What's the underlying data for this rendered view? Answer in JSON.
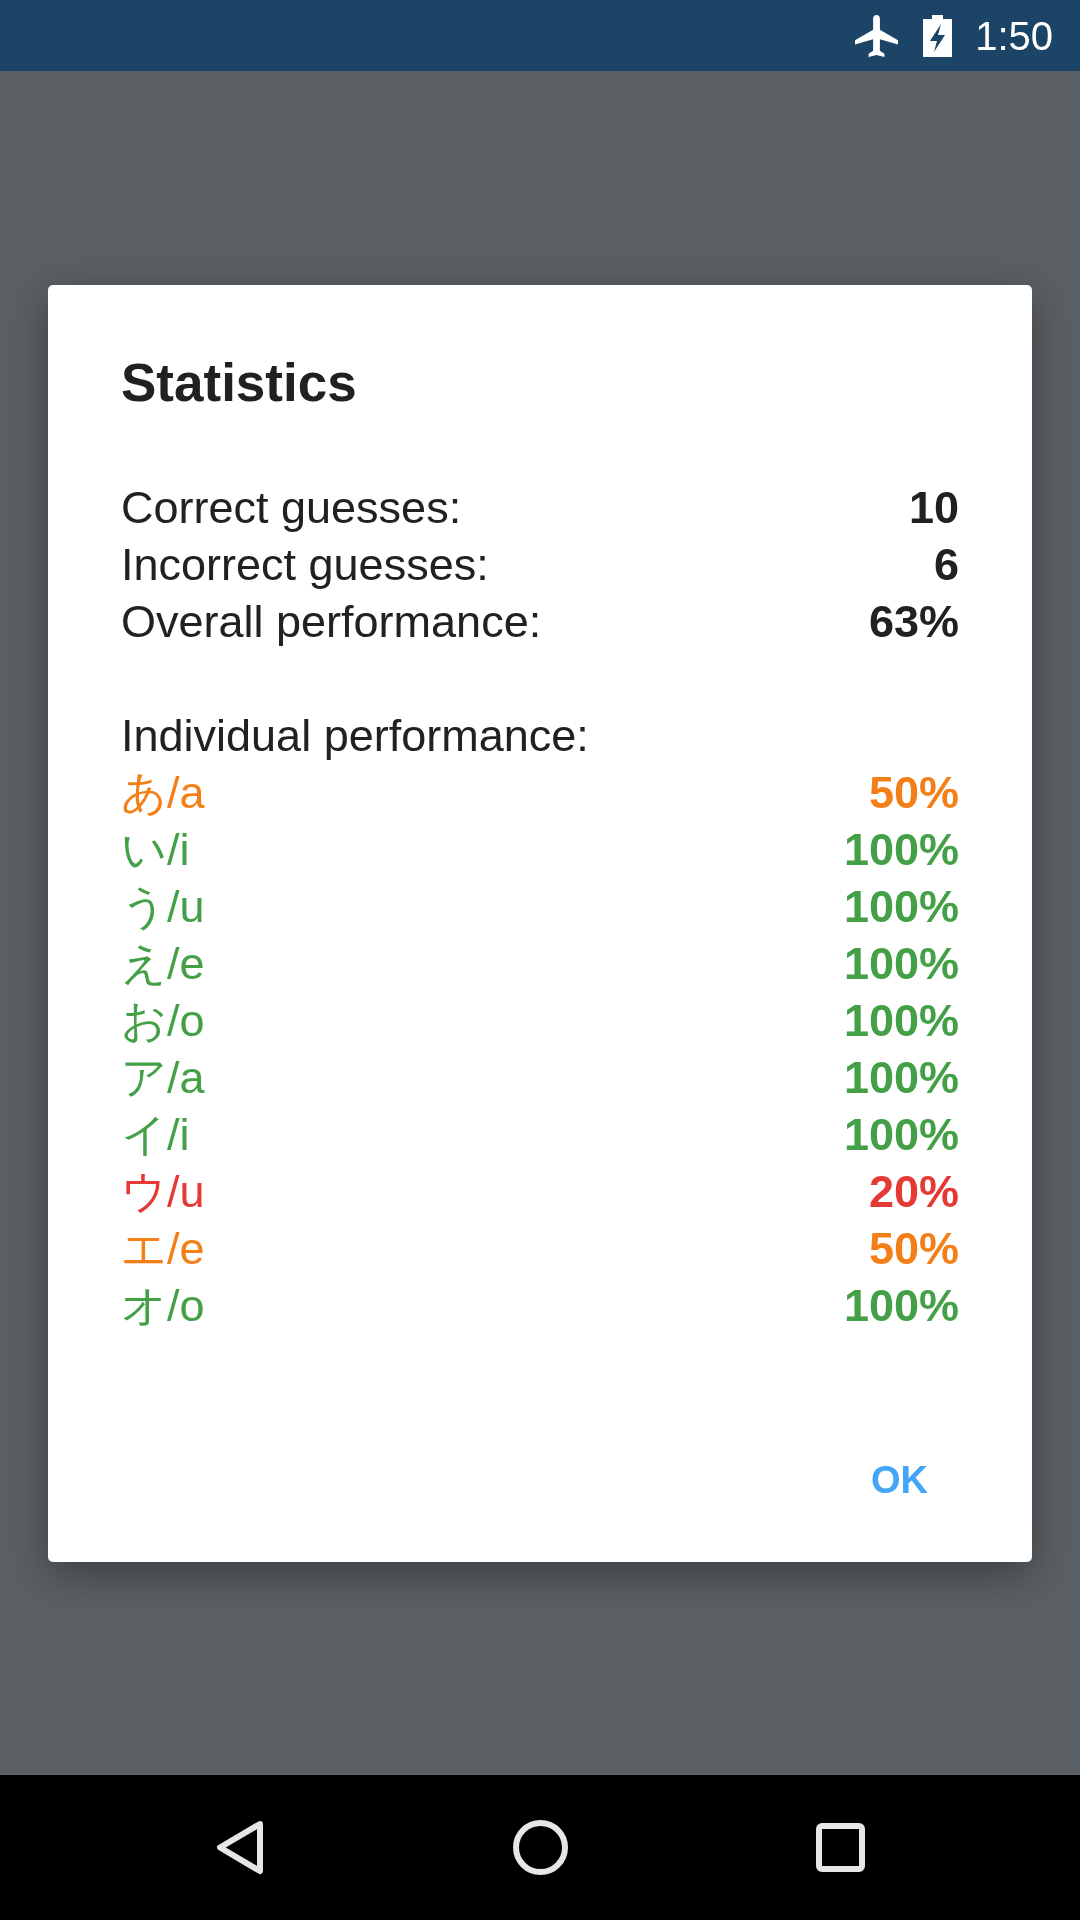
{
  "status_bar": {
    "time": "1:50"
  },
  "dialog": {
    "title": "Statistics",
    "summary": [
      {
        "label": "Correct guesses:",
        "value": "10"
      },
      {
        "label": "Incorrect guesses:",
        "value": "6"
      },
      {
        "label": "Overall performance:",
        "value": "63%"
      }
    ],
    "section_label": "Individual performance:",
    "items": [
      {
        "label": "あ/a",
        "value": "50%",
        "color": "#f57f17"
      },
      {
        "label": "い/i",
        "value": "100%",
        "color": "#43a047"
      },
      {
        "label": "う/u",
        "value": "100%",
        "color": "#43a047"
      },
      {
        "label": "え/e",
        "value": "100%",
        "color": "#43a047"
      },
      {
        "label": "お/o",
        "value": "100%",
        "color": "#43a047"
      },
      {
        "label": "ア/a",
        "value": "100%",
        "color": "#43a047"
      },
      {
        "label": "イ/i",
        "value": "100%",
        "color": "#43a047"
      },
      {
        "label": "ウ/u",
        "value": "20%",
        "color": "#e53935"
      },
      {
        "label": "エ/e",
        "value": "50%",
        "color": "#f57f17"
      },
      {
        "label": "オ/o",
        "value": "100%",
        "color": "#43a047"
      }
    ],
    "buttons": [
      "OK"
    ]
  }
}
